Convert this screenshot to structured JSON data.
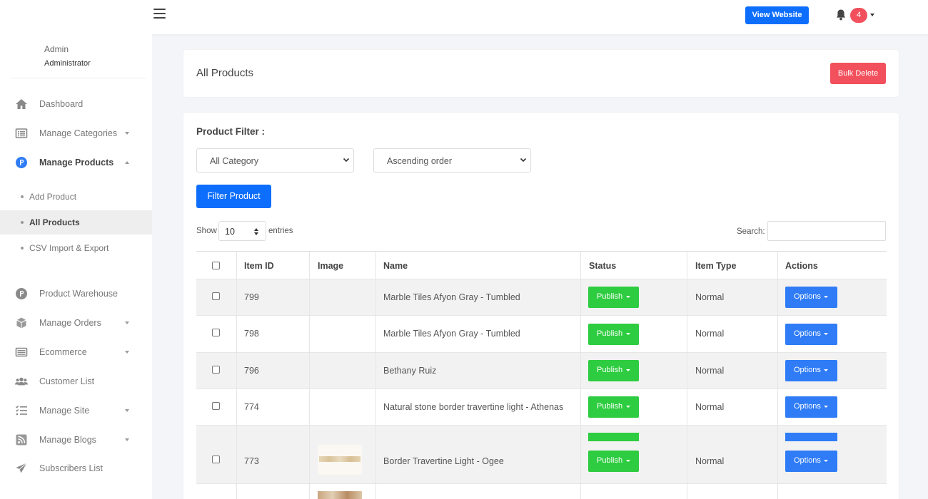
{
  "topbar": {
    "view_website": "View Website",
    "notification_count": "4"
  },
  "sidebar": {
    "user_name": "Admin",
    "user_role": "Administrator",
    "items": [
      {
        "label": "Dashboard",
        "icon": "home-icon"
      },
      {
        "label": "Manage Categories",
        "icon": "list-icon"
      },
      {
        "label": "Manage Products",
        "icon": "p-circle-icon"
      },
      {
        "label": "Product Warehouse",
        "icon": "p-circle-icon"
      },
      {
        "label": "Manage Orders",
        "icon": "cube-icon"
      },
      {
        "label": "Ecommerce",
        "icon": "card-list-icon"
      },
      {
        "label": "Customer List",
        "icon": "users-icon"
      },
      {
        "label": "Manage Site",
        "icon": "tasks-icon"
      },
      {
        "label": "Manage Blogs",
        "icon": "rss-icon"
      },
      {
        "label": "Subscribers List",
        "icon": "paper-plane-icon"
      }
    ],
    "sub_items": [
      {
        "label": "Add Product"
      },
      {
        "label": "All Products"
      },
      {
        "label": "CSV Import & Export"
      }
    ]
  },
  "header": {
    "title": "All Products",
    "bulk_delete": "Bulk Delete"
  },
  "filter": {
    "title": "Product Filter :",
    "category_value": "All Category",
    "order_value": "Ascending order",
    "button": "Filter Product"
  },
  "table_controls": {
    "show_label": "Show",
    "page_size": "10",
    "entries_label": "entries",
    "search_label": "Search:"
  },
  "table": {
    "columns": [
      "Item ID",
      "Image",
      "Name",
      "Status",
      "Item Type",
      "Actions"
    ],
    "rows": [
      {
        "id": "799",
        "name": "Marble Tiles Afyon Gray - Tumbled",
        "status": "Publish",
        "type": "Normal",
        "action": "Options"
      },
      {
        "id": "798",
        "name": "Marble Tiles Afyon Gray - Tumbled",
        "status": "Publish",
        "type": "Normal",
        "action": "Options"
      },
      {
        "id": "796",
        "name": "Bethany Ruiz",
        "status": "Publish",
        "type": "Normal",
        "action": "Options"
      },
      {
        "id": "774",
        "name": "Natural stone border travertine light - Athenas",
        "status": "Publish",
        "type": "Normal",
        "action": "Options"
      },
      {
        "id": "773",
        "name": "Border Travertine Light - Ogee",
        "status": "Publish",
        "type": "Normal",
        "action": "Options"
      }
    ]
  },
  "colors": {
    "primary": "#0d6efd",
    "danger": "#f1505c",
    "success": "#2ecc40",
    "options": "#2f7cf6"
  }
}
